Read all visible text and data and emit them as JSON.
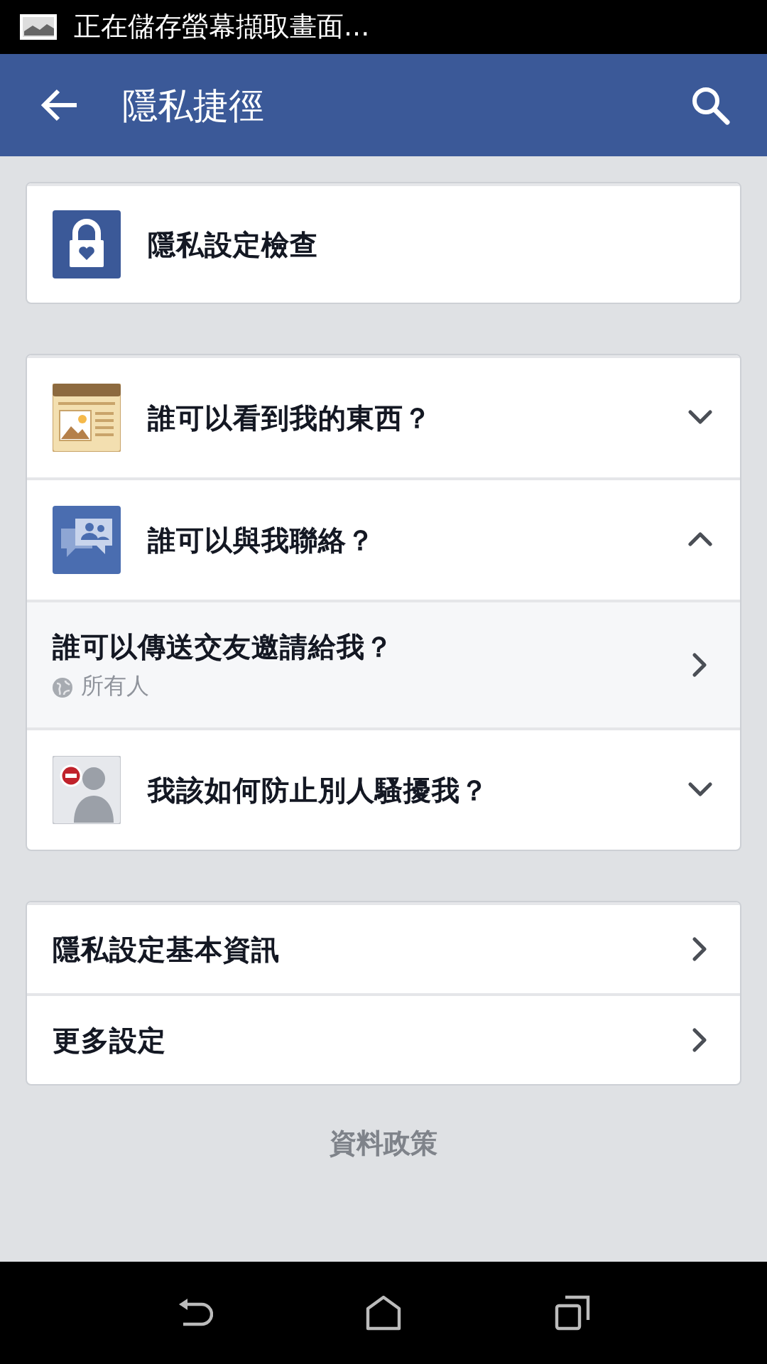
{
  "status_bar": {
    "notification": "正在儲存螢幕擷取畫面..."
  },
  "app_bar": {
    "title": "隱私捷徑"
  },
  "cards": [
    {
      "items": [
        {
          "kind": "shortcut",
          "label": "隱私設定檢查"
        }
      ]
    },
    {
      "items": [
        {
          "kind": "accordion",
          "label": "誰可以看到我的東西？",
          "expanded": false
        },
        {
          "kind": "accordion",
          "label": "誰可以與我聯絡？",
          "expanded": true
        },
        {
          "kind": "setting",
          "label": "誰可以傳送交友邀請給我？",
          "value": "所有人"
        },
        {
          "kind": "accordion",
          "label": "我該如何防止別人騷擾我？",
          "expanded": false
        }
      ]
    },
    {
      "items": [
        {
          "kind": "link",
          "label": "隱私設定基本資訊"
        },
        {
          "kind": "link",
          "label": "更多設定"
        }
      ]
    }
  ],
  "footer_link": "資料政策"
}
